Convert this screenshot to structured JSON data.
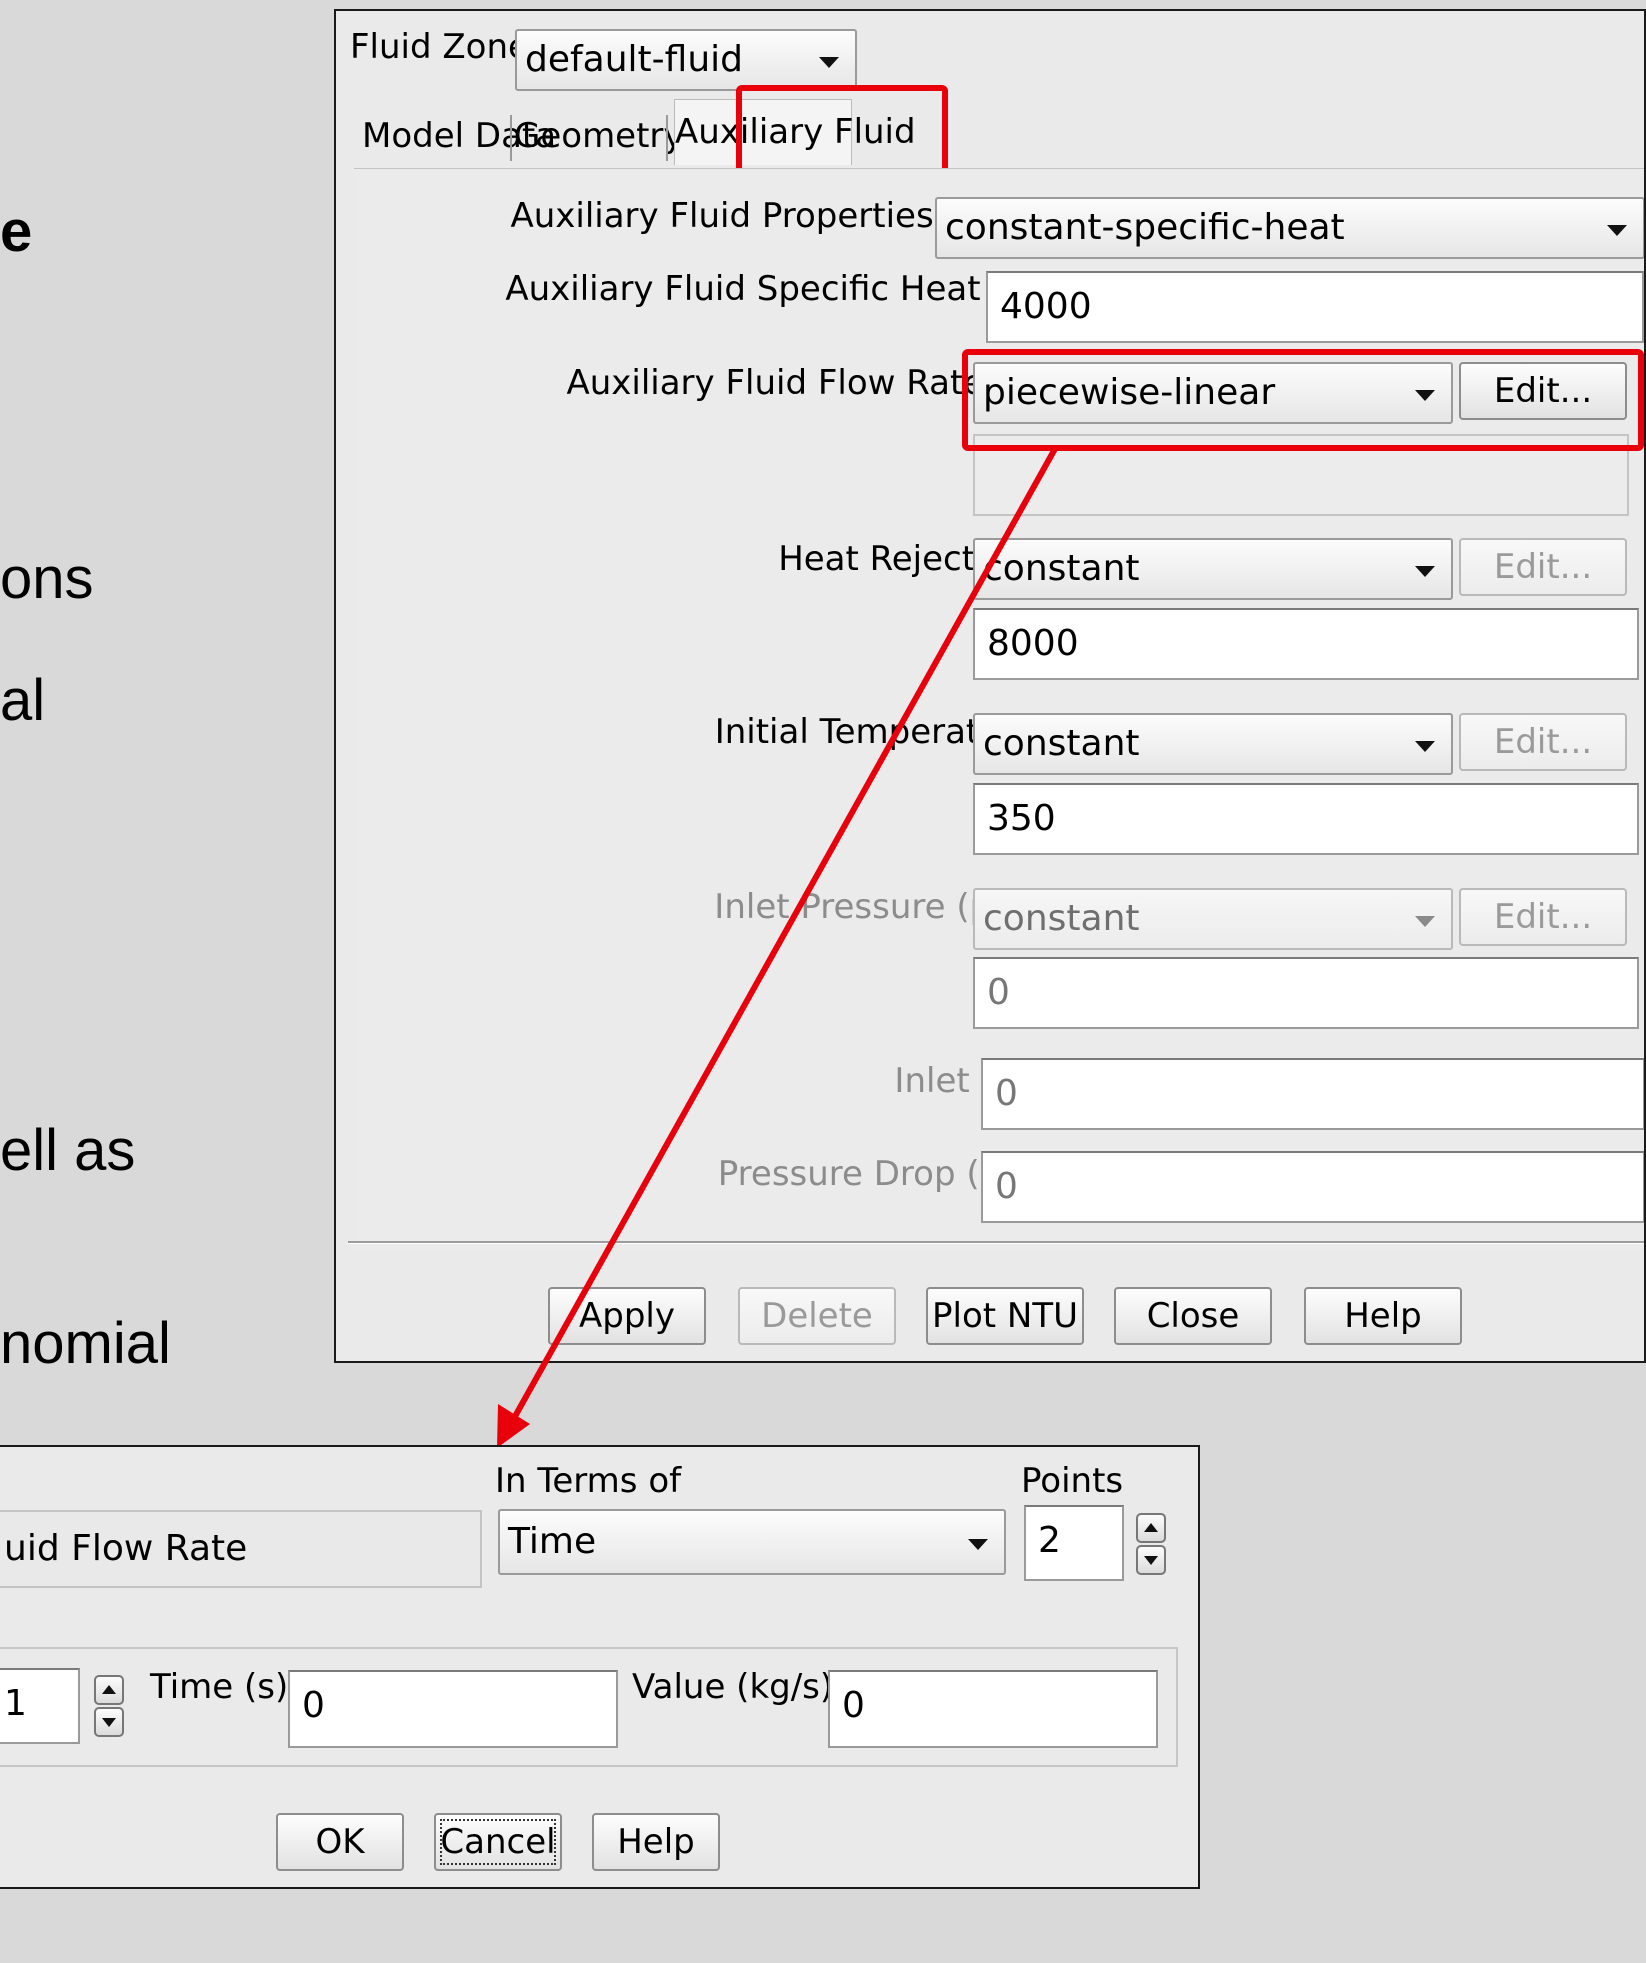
{
  "slide_fragments": [
    "e",
    "ons",
    "al",
    "ell as",
    "nomial"
  ],
  "main_dialog": {
    "fluid_zone_label": "Fluid Zone",
    "fluid_zone_value": "default-fluid",
    "tabs": [
      "Model Data",
      "Geometry",
      "Auxiliary Fluid"
    ],
    "active_tab": "Auxiliary Fluid",
    "rows": {
      "properties_method": {
        "label": "Auxiliary Fluid Properties Method",
        "value": "constant-specific-heat"
      },
      "specific_heat": {
        "label": "Auxiliary Fluid Specific Heat (j/kg-k)",
        "value": "4000"
      },
      "flow_rate": {
        "label": "Auxiliary Fluid Flow Rate (kg/s)",
        "value": "piecewise-linear",
        "edit": "Edit..."
      },
      "heat_rejection": {
        "label": "Heat Rejection (w)",
        "value": "constant",
        "edit": "Edit...",
        "field": "8000"
      },
      "initial_temperature": {
        "label": "Initial Temperature (k)",
        "value": "constant",
        "edit": "Edit...",
        "field": "350"
      },
      "inlet_pressure": {
        "label": "Inlet Pressure (pascal)",
        "value": "constant",
        "edit": "Edit...",
        "field": "0"
      },
      "inlet_quality": {
        "label": "Inlet Quality",
        "field": "0"
      },
      "pressure_drop": {
        "label": "Pressure Drop (pascal)",
        "field": "0"
      }
    },
    "buttons": {
      "apply": "Apply",
      "delete": "Delete",
      "plot_ntu": "Plot NTU",
      "close": "Close",
      "help": "Help"
    }
  },
  "sub_dialog": {
    "property_value": "uid Flow Rate",
    "in_terms_of_label": "In Terms of",
    "in_terms_of_value": "Time",
    "points_label": "Points",
    "points_value": "2",
    "point_index": "1",
    "time_label": "Time (s)",
    "time_value": "0",
    "value_label": "Value (kg/s)",
    "value_value": "0",
    "buttons": {
      "ok": "OK",
      "cancel": "Cancel",
      "help": "Help"
    }
  },
  "colors": {
    "highlight": "#e8000b",
    "dialog_bg": "#eaeaea",
    "background": "#d9d9d9"
  }
}
